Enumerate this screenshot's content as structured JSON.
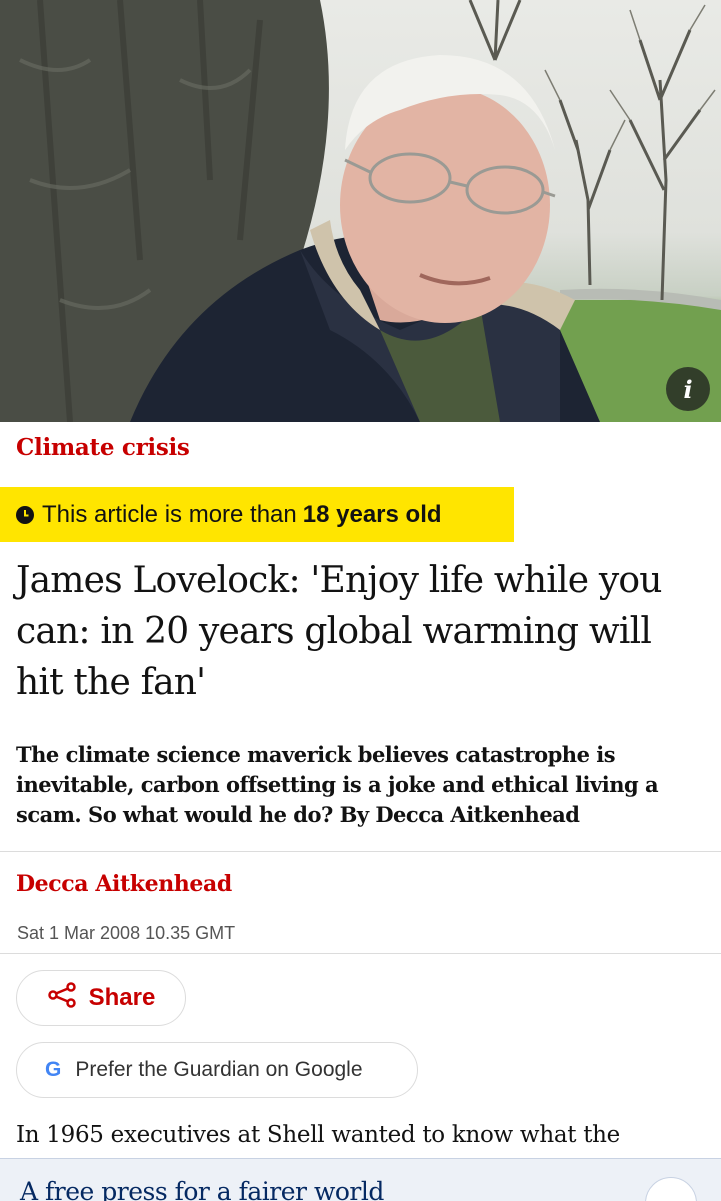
{
  "article": {
    "kicker": "Climate crisis",
    "age_notice": {
      "prefix": "This article is more than",
      "emphasis": "18 years old"
    },
    "headline": "James Lovelock: 'Enjoy life while you can: in 20 years global warming will hit the fan'",
    "standfirst": "The climate science maverick believes catastrophe is inevitable, carbon offsetting is a joke and ethical living a scam. So what would he do? By Decca Aitkenhead",
    "byline": "Decca Aitkenhead",
    "dateline": "Sat 1 Mar 2008 10.35 GMT",
    "body_first_line": "In 1965 executives at Shell wanted to know what the"
  },
  "hero": {
    "info_label": "i"
  },
  "actions": {
    "share_label": "Share",
    "google_logo": "G",
    "google_label": "Prefer the Guardian on Google"
  },
  "promo": {
    "title": "A free press for a fairer world"
  },
  "colors": {
    "accent_red": "#c70000",
    "banner_yellow": "#ffe500",
    "brand_blue": "#052962"
  },
  "icons": [
    "info-icon",
    "clock-icon",
    "share-icon",
    "google-icon"
  ]
}
